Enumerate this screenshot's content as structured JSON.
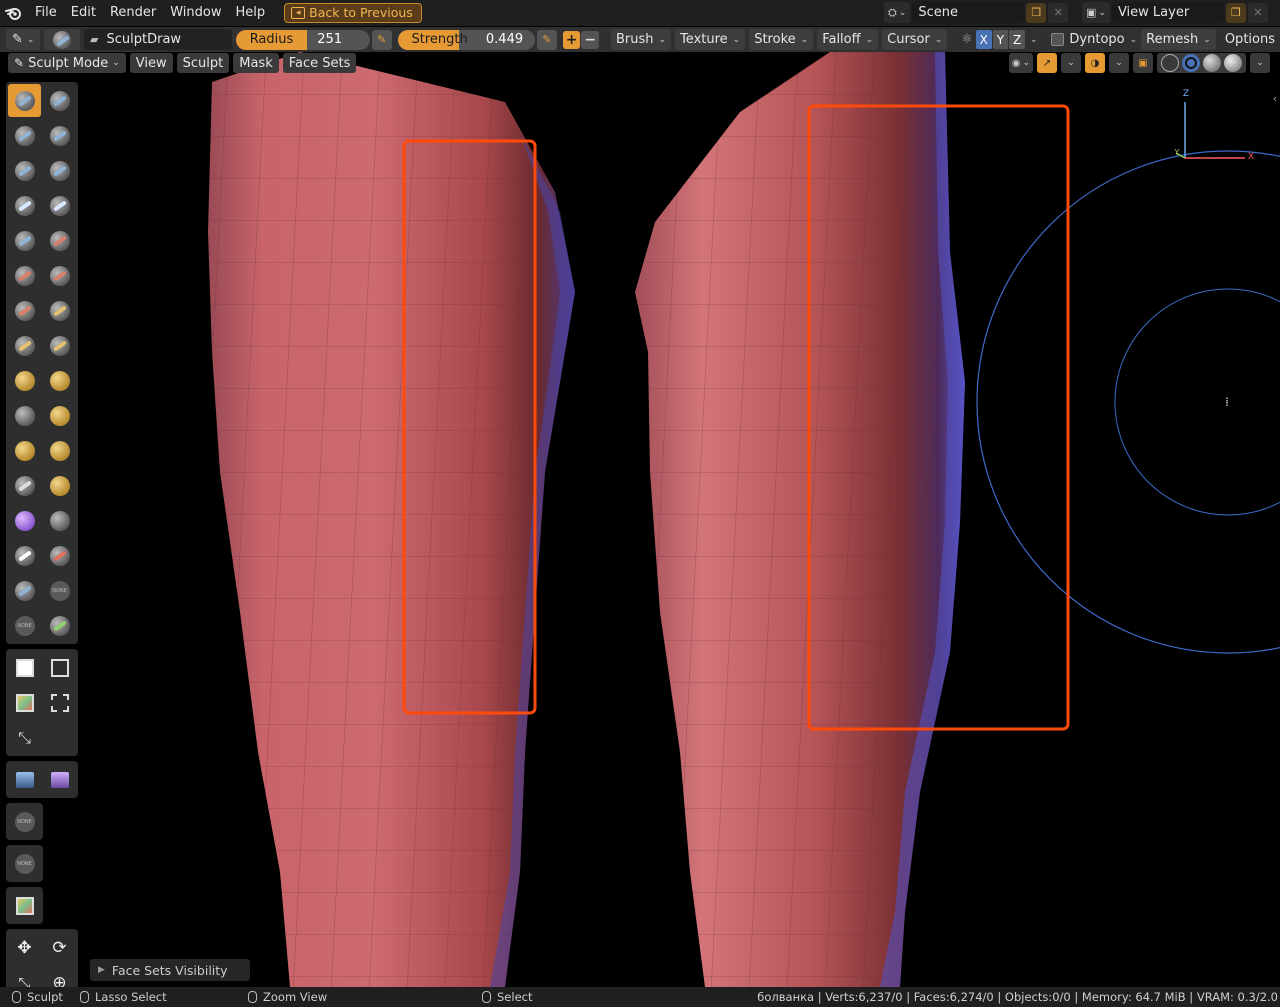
{
  "menubar": {
    "items": [
      "File",
      "Edit",
      "Render",
      "Window",
      "Help"
    ],
    "back_button": "Back to Previous",
    "scene": "Scene",
    "view_layer": "View Layer"
  },
  "toolheader": {
    "brush_name": "SculptDraw",
    "radius_label": "Radius",
    "radius_value": "251 px",
    "strength_label": "Strength",
    "strength_value": "0.449",
    "strength_fraction": 0.449,
    "dropdowns": [
      "Brush",
      "Texture",
      "Stroke",
      "Falloff",
      "Cursor"
    ],
    "axes": [
      "X",
      "Y",
      "Z"
    ],
    "dyntopo": "Dyntopo",
    "remesh": "Remesh",
    "options": "Options"
  },
  "viewport": {
    "mode": "Sculpt Mode",
    "menus": [
      "View",
      "Sculpt",
      "Mask",
      "Face Sets"
    ],
    "face_sets_panel": "Face Sets Visibility",
    "gizmo_axes": {
      "z": "Z",
      "y": "Y",
      "x": "X"
    }
  },
  "statusbar": {
    "mode": "Sculpt",
    "lasso": "Lasso Select",
    "zoom": "Zoom View",
    "select": "Select",
    "stats": "болванка | Verts:6,237/0 | Faces:6,274/0 | Objects:0/0 | Memory: 64.7 MiB | VRAM: 0.3/2.0"
  },
  "colors": {
    "accent": "#e69a34",
    "highlight_box": "#ff4a0a",
    "skin": "#c8646a"
  }
}
